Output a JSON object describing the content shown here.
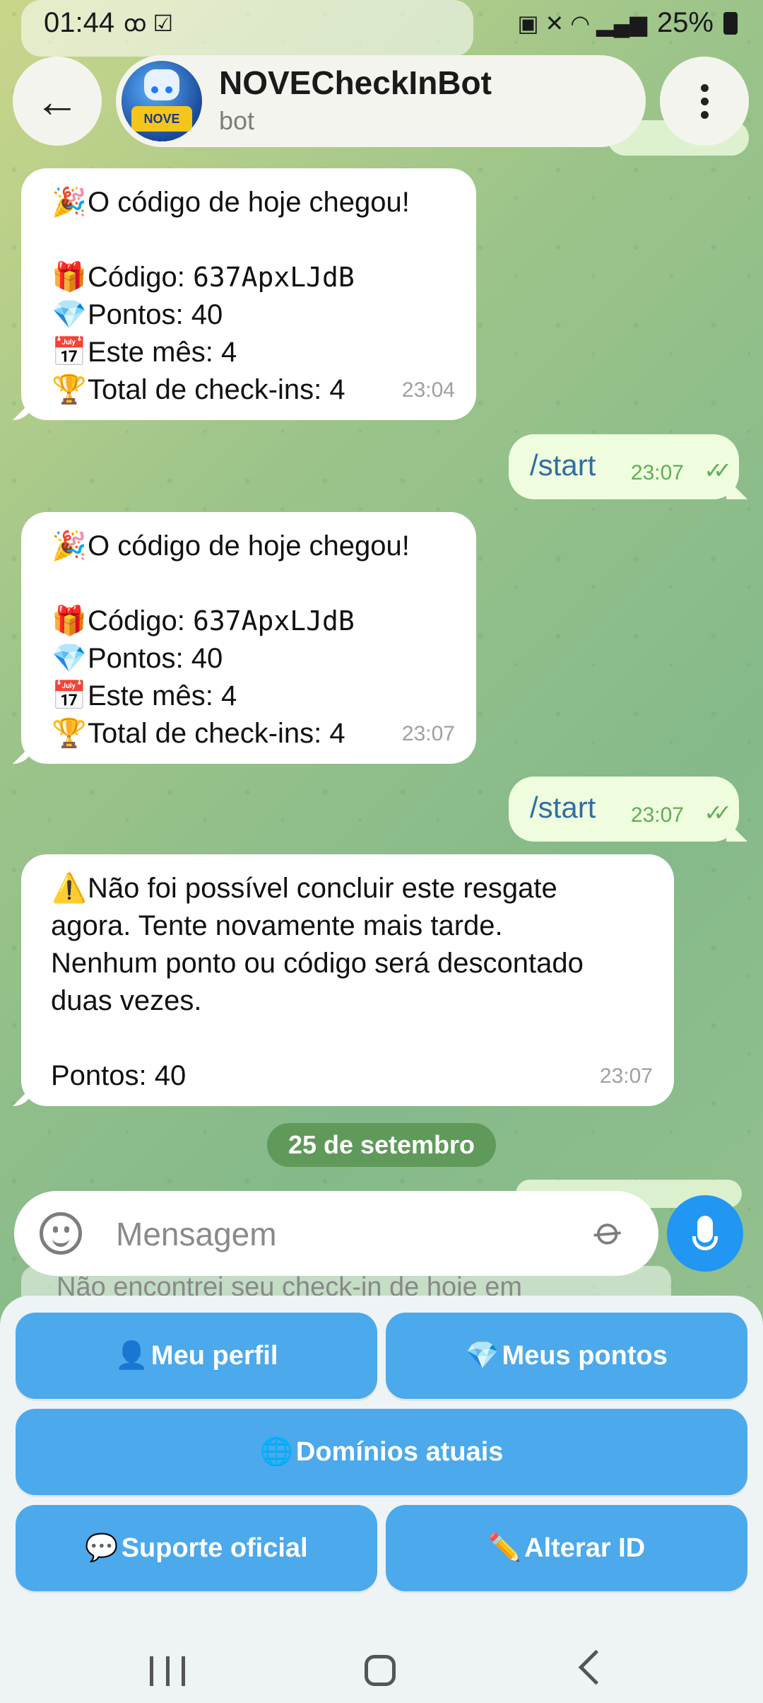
{
  "status_bar": {
    "time": "01:44",
    "battery": "25%"
  },
  "header": {
    "back_icon": "arrow-left-icon",
    "title": "NOVECheckInBot",
    "subtitle": "bot",
    "avatar_text": "NOVE GAMES",
    "menu_icon": "more-vertical-icon"
  },
  "messages": {
    "m1": {
      "title": "O código de hoje chegou!",
      "code_label": "Código: ",
      "code": "637ApxLJdB",
      "points": "Pontos: 40",
      "month": "Este mês: 4",
      "total": "Total de check-ins: 4",
      "time": "23:04"
    },
    "m2": {
      "text": "/start",
      "time": "23:07"
    },
    "m3": {
      "title": "O código de hoje chegou!",
      "code_label": "Código: ",
      "code": "637ApxLJdB",
      "points": "Pontos: 40",
      "month": "Este mês: 4",
      "total": "Total de check-ins: 4",
      "time": "23:07"
    },
    "m4": {
      "text": "/start",
      "time": "23:07"
    },
    "m5": {
      "line1": "Não foi possível concluir este resgate",
      "line2": "agora. Tente novamente mais tarde.",
      "line3": "Nenhum ponto ou código será descontado",
      "line4": "duas vezes.",
      "points": "Pontos: 40",
      "time": "23:07"
    }
  },
  "date_separator": "25 de setembro",
  "composer": {
    "placeholder": "Mensagem"
  },
  "keyboard_peek": "Não encontrei seu check-in de hoje em",
  "keyboard": {
    "profile": "Meu perfil",
    "points": "Meus pontos",
    "domains": "Domínios atuais",
    "support": "Suporte oficial",
    "change_id": "Alterar ID"
  }
}
